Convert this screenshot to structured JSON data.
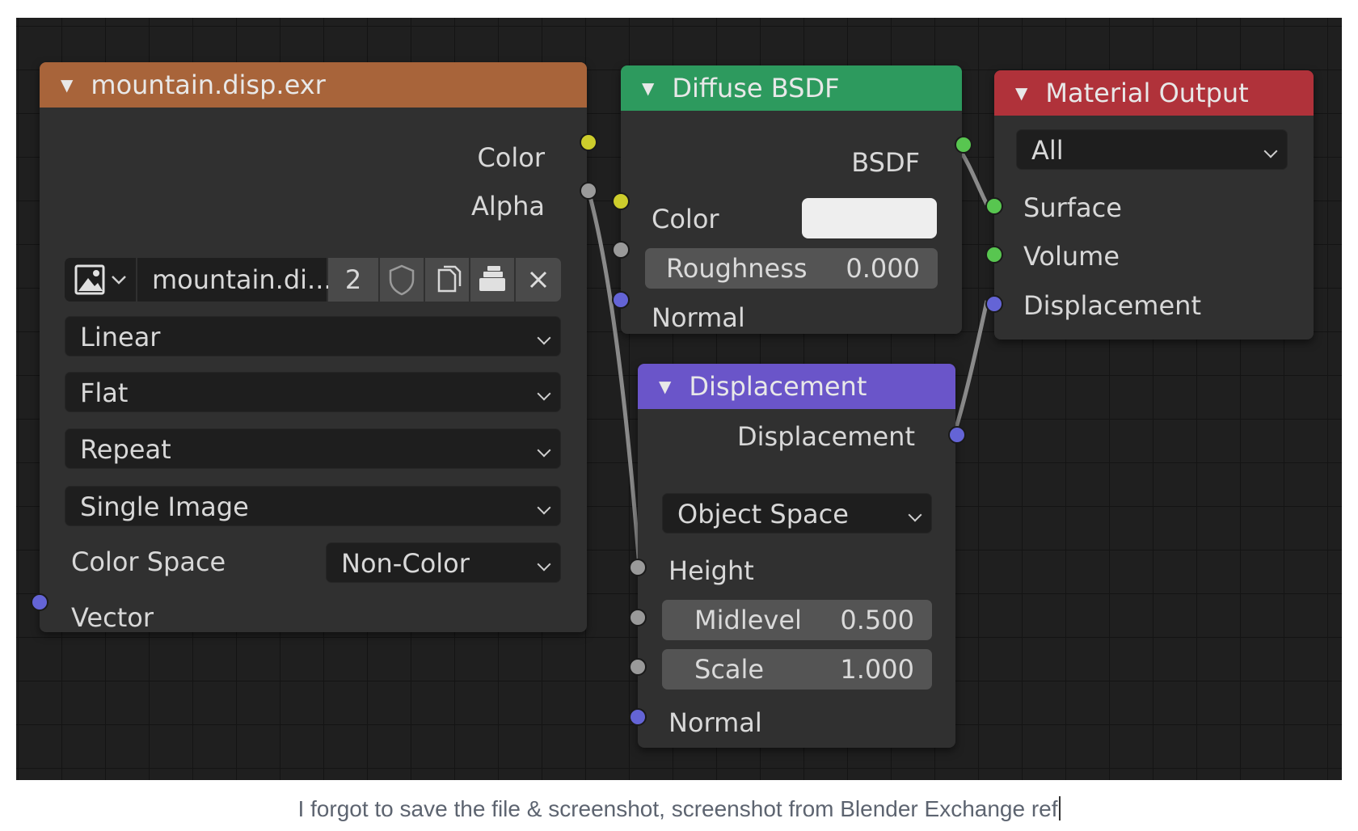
{
  "image_node": {
    "title": "mountain.disp.exr",
    "header_color": "#a8643a",
    "outputs": [
      "Color",
      "Alpha"
    ],
    "image_name": "mountain.di...",
    "users": "2",
    "interpolation": "Linear",
    "projection": "Flat",
    "extension": "Repeat",
    "source": "Single Image",
    "color_space_label": "Color Space",
    "color_space_value": "Non-Color",
    "input": "Vector"
  },
  "diffuse_node": {
    "title": "Diffuse BSDF",
    "header_color": "#2d9a5e",
    "output": "BSDF",
    "color_label": "Color",
    "color_value": "#eeeeee",
    "roughness_label": "Roughness",
    "roughness_value": "0.000",
    "normal_label": "Normal"
  },
  "displacement_node": {
    "title": "Displacement",
    "header_color": "#6a55c9",
    "output": "Displacement",
    "space": "Object Space",
    "height_label": "Height",
    "midlevel_label": "Midlevel",
    "midlevel_value": "0.500",
    "scale_label": "Scale",
    "scale_value": "1.000",
    "normal_label": "Normal"
  },
  "output_node": {
    "title": "Material Output",
    "header_color": "#b0323a",
    "target": "All",
    "inputs": [
      "Surface",
      "Volume",
      "Displacement"
    ]
  },
  "socket_colors": {
    "color": "#cdcd2c",
    "float": "#9a9a9a",
    "vector": "#6464d6",
    "shader": "#58c650"
  },
  "icons": [
    "image-icon",
    "chevron-down-icon",
    "fake-user-shield-icon",
    "duplicate-icon",
    "pack-icon",
    "close-icon",
    "collapse-triangle-icon"
  ],
  "caption": "I forgot to save the file & screenshot, screenshot from Blender Exchange ref"
}
